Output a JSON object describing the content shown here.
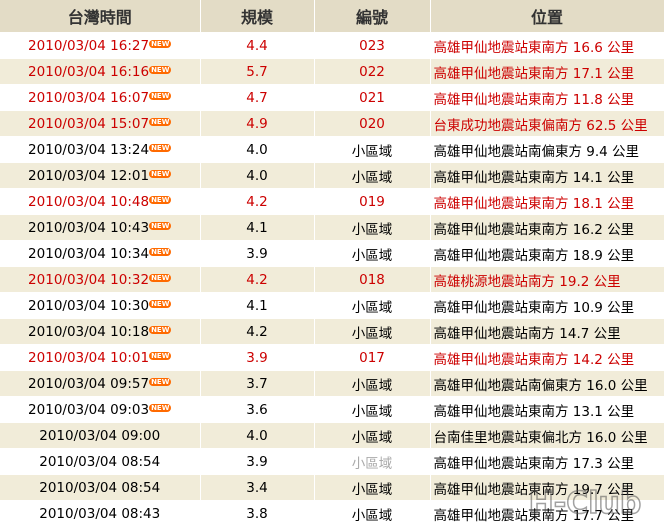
{
  "headers": {
    "time": "台灣時間",
    "magnitude": "規模",
    "number": "編號",
    "location": "位置"
  },
  "new_label": "NEW",
  "rows": [
    {
      "time": "2010/03/04 16:27",
      "new": true,
      "mag": "4.4",
      "num": "023",
      "loc": "高雄甲仙地震站東南方 16.6 公里",
      "felt": true
    },
    {
      "time": "2010/03/04 16:16",
      "new": true,
      "mag": "5.7",
      "num": "022",
      "loc": "高雄甲仙地震站東南方 17.1 公里",
      "felt": true
    },
    {
      "time": "2010/03/04 16:07",
      "new": true,
      "mag": "4.7",
      "num": "021",
      "loc": "高雄甲仙地震站東南方 11.8 公里",
      "felt": true
    },
    {
      "time": "2010/03/04 15:07",
      "new": true,
      "mag": "4.9",
      "num": "020",
      "loc": "台東成功地震站東偏南方 62.5 公里",
      "felt": true
    },
    {
      "time": "2010/03/04 13:24",
      "new": true,
      "mag": "4.0",
      "num": "小區域",
      "loc": "高雄甲仙地震站南偏東方 9.4 公里",
      "felt": false
    },
    {
      "time": "2010/03/04 12:01",
      "new": true,
      "mag": "4.0",
      "num": "小區域",
      "loc": "高雄甲仙地震站東南方 14.1 公里",
      "felt": false
    },
    {
      "time": "2010/03/04 10:48",
      "new": true,
      "mag": "4.2",
      "num": "019",
      "loc": "高雄甲仙地震站東南方 18.1 公里",
      "felt": true
    },
    {
      "time": "2010/03/04 10:43",
      "new": true,
      "mag": "4.1",
      "num": "小區域",
      "loc": "高雄甲仙地震站東南方 16.2 公里",
      "felt": false
    },
    {
      "time": "2010/03/04 10:34",
      "new": true,
      "mag": "3.9",
      "num": "小區域",
      "loc": "高雄甲仙地震站東南方 18.9 公里",
      "felt": false
    },
    {
      "time": "2010/03/04 10:32",
      "new": true,
      "mag": "4.2",
      "num": "018",
      "loc": "高雄桃源地震站南方 19.2 公里",
      "felt": true
    },
    {
      "time": "2010/03/04 10:30",
      "new": true,
      "mag": "4.1",
      "num": "小區域",
      "loc": "高雄甲仙地震站東南方 10.9 公里",
      "felt": false
    },
    {
      "time": "2010/03/04 10:18",
      "new": true,
      "mag": "4.2",
      "num": "小區域",
      "loc": "高雄甲仙地震站南方 14.7 公里",
      "felt": false
    },
    {
      "time": "2010/03/04 10:01",
      "new": true,
      "mag": "3.9",
      "num": "017",
      "loc": "高雄甲仙地震站東南方 14.2 公里",
      "felt": true
    },
    {
      "time": "2010/03/04 09:57",
      "new": true,
      "mag": "3.7",
      "num": "小區域",
      "loc": "高雄甲仙地震站南偏東方 16.0 公里",
      "felt": false
    },
    {
      "time": "2010/03/04 09:03",
      "new": true,
      "mag": "3.6",
      "num": "小區域",
      "loc": "高雄甲仙地震站東南方 13.1 公里",
      "felt": false
    },
    {
      "time": "2010/03/04 09:00",
      "new": false,
      "mag": "4.0",
      "num": "小區域",
      "loc": "台南佳里地震站東偏北方 16.0 公里",
      "felt": false
    },
    {
      "time": "2010/03/04 08:54",
      "new": false,
      "mag": "3.9",
      "num": "小區域",
      "loc": "高雄甲仙地震站東南方 17.3 公里",
      "felt": false,
      "num_gray": true
    },
    {
      "time": "2010/03/04 08:54",
      "new": false,
      "mag": "3.4",
      "num": "小區域",
      "loc": "高雄甲仙地震站東南方 19.7 公里",
      "felt": false
    },
    {
      "time": "2010/03/04 08:43",
      "new": false,
      "mag": "3.8",
      "num": "小區域",
      "loc": "高雄甲仙地震站東南方 17.7 公里",
      "felt": false
    }
  ],
  "watermark": "H-Club",
  "colors": {
    "felt": "#cc0000",
    "header_bg": "#e3dcc6",
    "stripe": "#f1ecd9",
    "new_badge": "#ff6a00"
  }
}
